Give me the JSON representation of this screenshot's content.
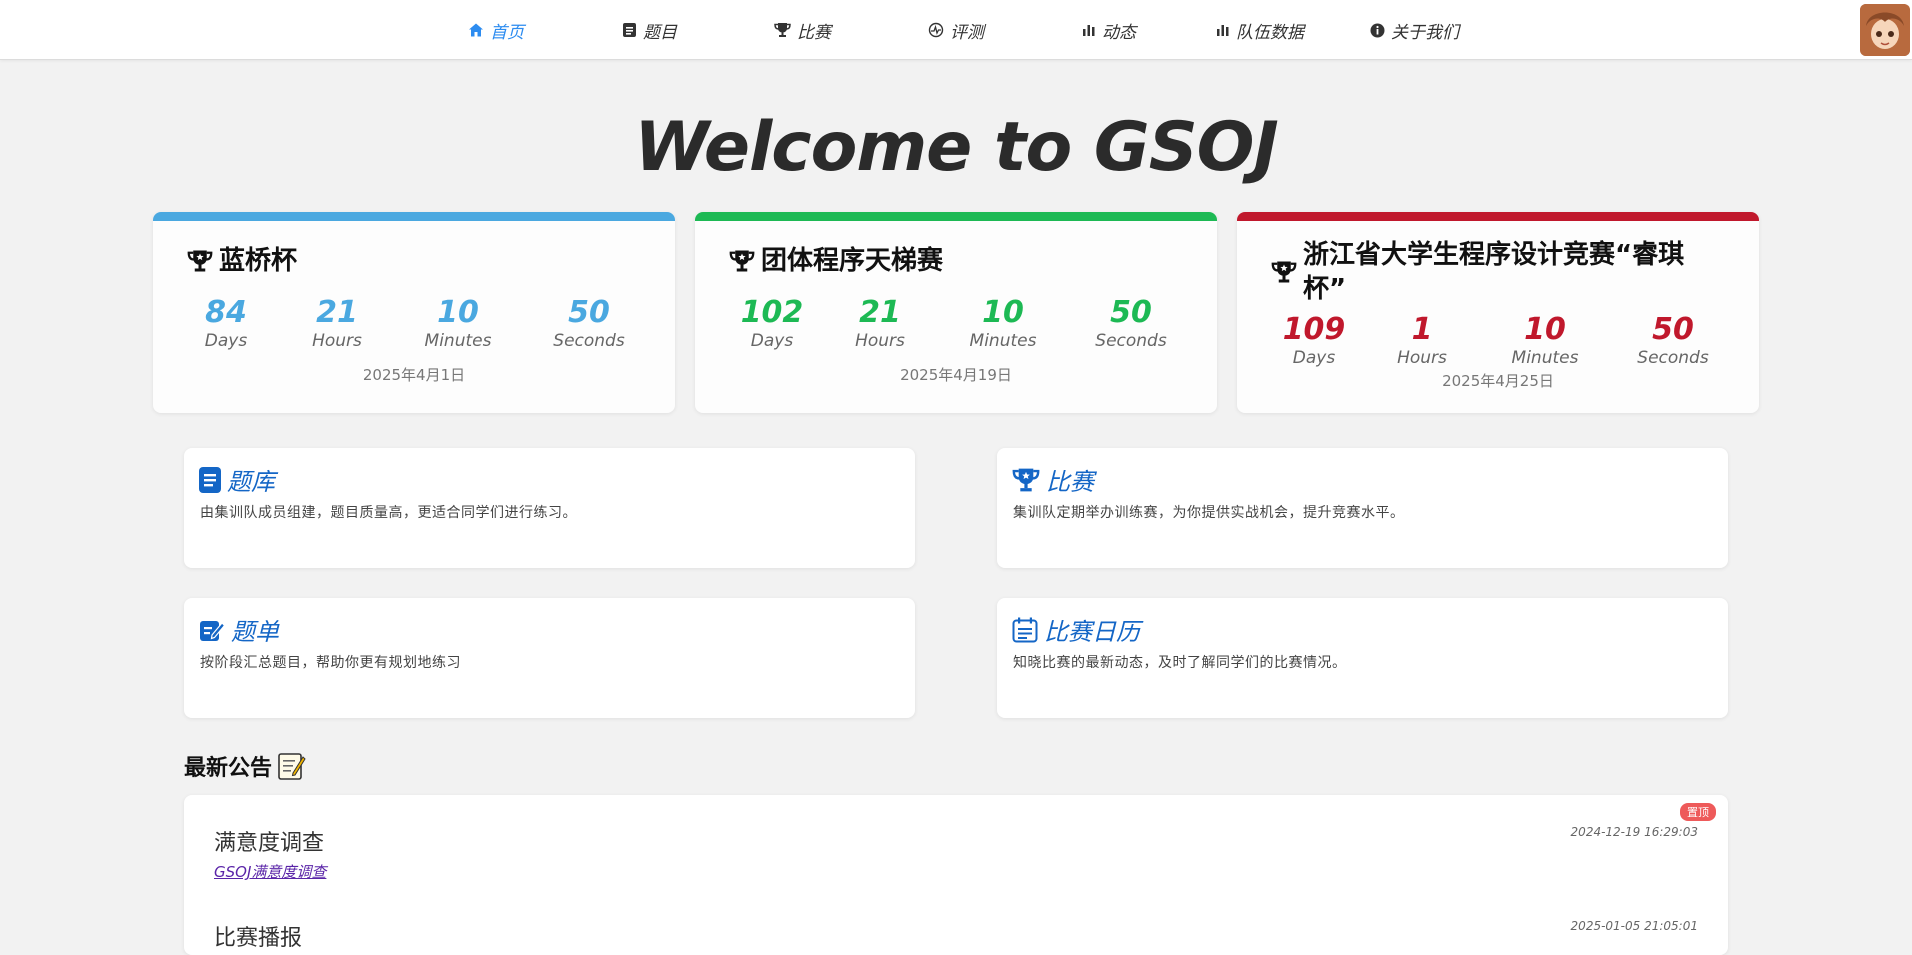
{
  "nav": {
    "items": [
      {
        "label": "首页",
        "icon": "home-icon"
      },
      {
        "label": "题目",
        "icon": "document-icon"
      },
      {
        "label": "比赛",
        "icon": "trophy-icon"
      },
      {
        "label": "评测",
        "icon": "judge-icon"
      },
      {
        "label": "动态",
        "icon": "bar-chart-icon"
      },
      {
        "label": "队伍数据",
        "icon": "bar-chart-icon"
      },
      {
        "label": "关于我们",
        "icon": "info-icon"
      }
    ],
    "active_color": "#2d8cf0"
  },
  "hero": {
    "title": "Welcome to GSOJ"
  },
  "countdowns": [
    {
      "title": "蓝桥杯",
      "color": "#4aa8e0",
      "days": "84",
      "hours": "21",
      "minutes": "10",
      "seconds": "50",
      "date": "2025年4月1日"
    },
    {
      "title": "团体程序天梯赛",
      "color": "#1db954",
      "days": "102",
      "hours": "21",
      "minutes": "10",
      "seconds": "50",
      "date": "2025年4月19日"
    },
    {
      "title": "浙江省大学生程序设计竞赛“睿琪杯”",
      "color": "#c0182c",
      "days": "109",
      "hours": "1",
      "minutes": "10",
      "seconds": "50",
      "date": "2025年4月25日"
    }
  ],
  "units": {
    "days": "Days",
    "hours": "Hours",
    "minutes": "Minutes",
    "seconds": "Seconds"
  },
  "features": [
    {
      "title": "题库",
      "desc": "由集训队成员组建，题目质量高，更适合同学们进行练习。",
      "icon": "document-icon"
    },
    {
      "title": "比赛",
      "desc": "集训队定期举办训练赛，为你提供实战机会，提升竞赛水平。",
      "icon": "trophy-icon"
    },
    {
      "title": "题单",
      "desc": "按阶段汇总题目，帮助你更有规划地练习",
      "icon": "edit-icon"
    },
    {
      "title": "比赛日历",
      "desc": "知晓比赛的最新动态，及时了解同学们的比赛情况。",
      "icon": "calendar-icon"
    }
  ],
  "feature_color": "#1466c6",
  "announcements": {
    "heading": "最新公告",
    "heading_icon": "memo-icon",
    "items": [
      {
        "title": "满意度调查",
        "link": "GSOJ满意度调查",
        "time": "2024-12-19 16:29:03",
        "badge": "置顶"
      },
      {
        "title": "比赛播报",
        "time": "2025-01-05 21:05:01"
      }
    ]
  }
}
